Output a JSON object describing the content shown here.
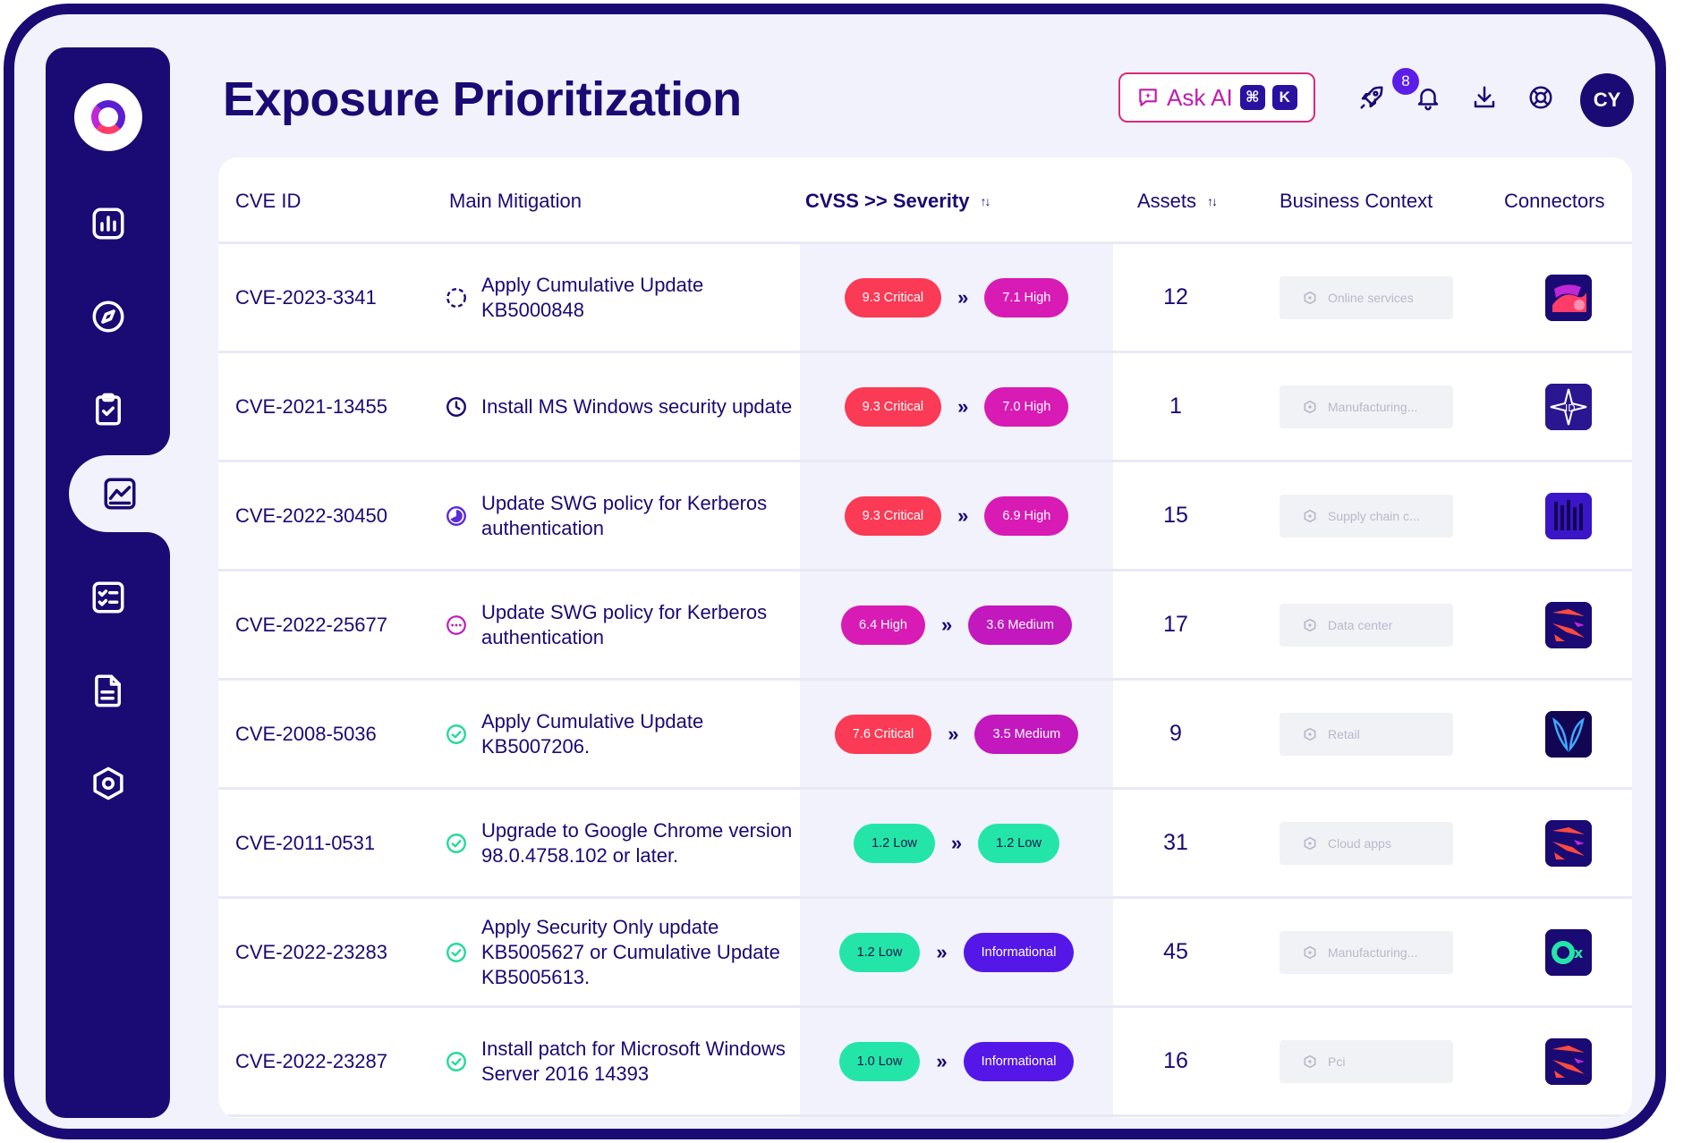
{
  "page": {
    "title": "Exposure Prioritization"
  },
  "header": {
    "ask_ai_label": "Ask AI",
    "shortcut_cmd": "⌘",
    "shortcut_key": "K",
    "notification_count": "8",
    "avatar_initials": "CY"
  },
  "sidebar": {
    "items": [
      {
        "icon": "bar-chart-icon"
      },
      {
        "icon": "compass-icon"
      },
      {
        "icon": "clipboard-check-icon"
      },
      {
        "icon": "line-chart-icon",
        "active": true
      },
      {
        "icon": "checklist-icon"
      },
      {
        "icon": "document-icon"
      },
      {
        "icon": "settings-hexagon-icon"
      }
    ]
  },
  "table": {
    "headers": {
      "cve": "CVE ID",
      "mitigation": "Main Mitigation",
      "severity": "CVSS >> Severity",
      "assets": "Assets",
      "context": "Business Context",
      "connectors": "Connectors"
    },
    "rows": [
      {
        "cve": "CVE-2023-3341",
        "mitigation": "Apply Cumulative Update KB5000848",
        "status_icon": "pending-icon",
        "cvss": "9.3 Critical",
        "severity": "7.1 High",
        "assets": "12",
        "context": "Online services",
        "connector": "connector-abstract-logo"
      },
      {
        "cve": "CVE-2021-13455",
        "mitigation": "Install MS Windows security update",
        "status_icon": "clock-icon",
        "cvss": "9.3 Critical",
        "severity": "7.0 High",
        "assets": "1",
        "context": "Manufacturing...",
        "connector": "connector-sparkle-logo"
      },
      {
        "cve": "CVE-2022-30450",
        "mitigation": "Update SWG policy for Kerberos authentication",
        "status_icon": "half-progress-icon",
        "cvss": "9.3 Critical",
        "severity": "6.9 High",
        "assets": "15",
        "context": "Supply chain c...",
        "connector": "connector-bars-logo"
      },
      {
        "cve": "CVE-2022-25677",
        "mitigation": "Update SWG policy for Kerberos authentication",
        "status_icon": "more-dots-icon",
        "cvss": "6.4 High",
        "severity": "3.6 Medium",
        "assets": "17",
        "context": "Data center",
        "connector": "connector-stripes-logo"
      },
      {
        "cve": "CVE-2008-5036",
        "mitigation": "Apply Cumulative Update KB5007206.",
        "status_icon": "check-circle-icon",
        "cvss": "7.6 Critical",
        "severity": "3.5 Medium",
        "assets": "9",
        "context": "Retail",
        "connector": "connector-wings-logo"
      },
      {
        "cve": "CVE-2011-0531",
        "mitigation": "Upgrade to Google Chrome version 98.0.4758.102 or later.",
        "status_icon": "check-circle-icon",
        "cvss": "1.2 Low",
        "severity": "1.2 Low",
        "assets": "31",
        "context": "Cloud apps",
        "connector": "connector-stripes-logo"
      },
      {
        "cve": "CVE-2022-23283",
        "mitigation": "Apply Security Only update KB5005627 or Cumulative Update KB5005613.",
        "status_icon": "check-circle-icon",
        "cvss": "1.2 Low",
        "severity": "Informational",
        "assets": "45",
        "context": "Manufacturing...",
        "connector": "connector-ox-logo"
      },
      {
        "cve": "CVE-2022-23287",
        "mitigation": "Install patch for Microsoft Windows Server 2016 14393",
        "status_icon": "check-circle-icon",
        "cvss": "1.0 Low",
        "severity": "Informational",
        "assets": "16",
        "context": "Pci",
        "connector": "connector-stripes-logo"
      }
    ]
  },
  "colors": {
    "critical": "#fb3a55",
    "high": "#d81bb4",
    "medium": "#c218bd",
    "low": "#24e5a8",
    "informational": "#5417e8",
    "navy": "#1a0a73"
  }
}
